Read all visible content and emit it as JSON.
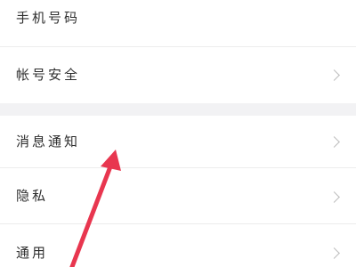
{
  "settings": {
    "items": [
      {
        "label": "手机号码",
        "has_chevron": false
      },
      {
        "label": "帐号安全",
        "has_chevron": true
      },
      {
        "label": "消息通知",
        "has_chevron": true
      },
      {
        "label": "隐私",
        "has_chevron": true
      },
      {
        "label": "通用",
        "has_chevron": true
      }
    ]
  },
  "icons": {
    "chevron": "chevron-right-icon",
    "annotation": "red-arrow-annotation"
  },
  "colors": {
    "background": "#ffffff",
    "section_gap": "#f2f2f4",
    "text": "#2f2f2f",
    "chevron": "#bdbdbd",
    "annotation": "#e8364f"
  }
}
